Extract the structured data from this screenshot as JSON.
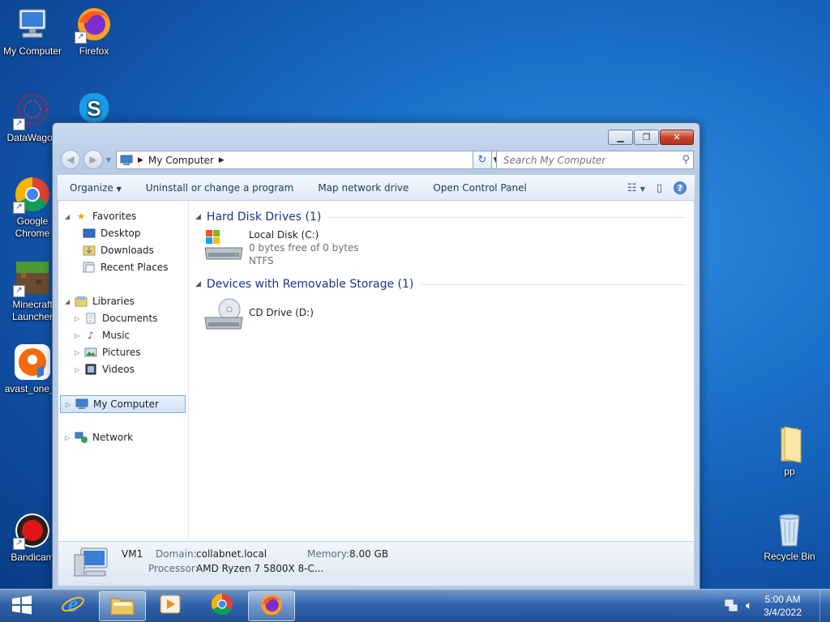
{
  "desktop": {
    "icons": {
      "my_computer": "My Computer",
      "firefox": "Firefox",
      "datawagon": "DataWagon",
      "chrome_line1": "Google",
      "chrome_line2": "Chrome",
      "minecraft_line1": "Minecraft",
      "minecraft_line2": "Launcher",
      "avast": "avast_one_e",
      "bandicam": "Bandicam",
      "pp": "pp",
      "recycle_bin": "Recycle Bin"
    }
  },
  "window": {
    "address": {
      "crumb": "My Computer"
    },
    "search": {
      "placeholder": "Search My Computer"
    },
    "toolbar": {
      "organize": "Organize",
      "uninstall": "Uninstall or change a program",
      "map_drive": "Map network drive",
      "control_panel": "Open Control Panel"
    },
    "sidebar": {
      "favorites": "Favorites",
      "desktop": "Desktop",
      "downloads": "Downloads",
      "recent": "Recent Places",
      "libraries": "Libraries",
      "documents": "Documents",
      "music": "Music",
      "pictures": "Pictures",
      "videos": "Videos",
      "my_computer": "My Computer",
      "network": "Network"
    },
    "groups": {
      "hard_disks": "Hard Disk Drives (1)",
      "removable": "Devices with Removable Storage (1)"
    },
    "drives": {
      "c_name": "Local Disk (C:)",
      "c_space": "0 bytes free of 0 bytes",
      "c_fs": "NTFS",
      "d_name": "CD Drive (D:)"
    },
    "details": {
      "name": "VM1",
      "domain_label": "Domain:",
      "domain_value": "collabnet.local",
      "memory_label": "Memory:",
      "memory_value": "8.00 GB",
      "processor_label": "Processor:",
      "processor_value": "AMD Ryzen 7 5800X 8-C..."
    }
  },
  "taskbar": {
    "time": "5:00 AM",
    "date": "3/4/2022"
  },
  "colors": {
    "desktop_blue": "#1a6cc7",
    "group_header": "#1e3287",
    "close_red": "#c6452b"
  }
}
